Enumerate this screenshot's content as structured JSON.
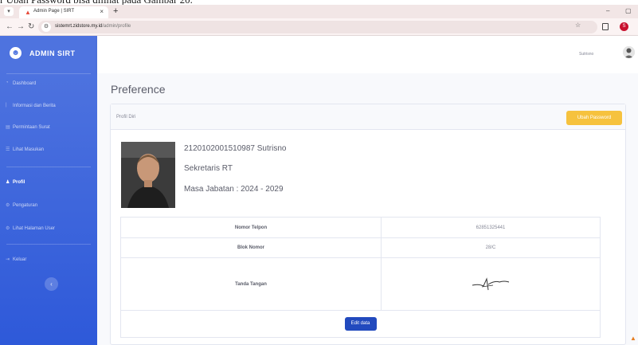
{
  "caption": "r Ubah Password bisa dilihat pada Gambar 20.",
  "browser": {
    "tab_title": "Admin Page | SIRT",
    "url_domain": "sistemrt.zidstore.my.id",
    "url_path": "/admin/profile",
    "profile_letter": "S"
  },
  "sidebar": {
    "brand": "ADMIN SIRT",
    "items": [
      {
        "label": "Dashboard",
        "icon": "dashboard-icon"
      },
      {
        "label": "Informasi dan Berita",
        "icon": "info-icon"
      },
      {
        "label": "Permintaan Surat",
        "icon": "mail-icon"
      },
      {
        "label": "Lihat Masukan",
        "icon": "comments-icon"
      },
      {
        "label": "Profil",
        "icon": "user-icon",
        "active": true
      },
      {
        "label": "Pengaturan",
        "icon": "settings-icon"
      },
      {
        "label": "Lihat Halaman User",
        "icon": "external-icon"
      },
      {
        "label": "Keluar",
        "icon": "logout-icon"
      }
    ],
    "toggle_glyph": "‹"
  },
  "topbar": {
    "user_name": "Sutrisno"
  },
  "main": {
    "page_title": "Preference",
    "card_title": "Profil Diri",
    "change_password_label": "Ubah Password",
    "profile": {
      "name_line": "2120102001510987 Sutrisno",
      "role": "Sekretaris RT",
      "term": "Masa Jabatan : 2024 - 2029"
    },
    "table": [
      {
        "label": "Nomor Telpon",
        "value": "62851325441"
      },
      {
        "label": "Blok Nomor",
        "value": "28/C"
      },
      {
        "label": "Tanda Tangan",
        "value": ""
      }
    ],
    "edit_label": "Edit data"
  },
  "colors": {
    "sidebar": "#4e73df",
    "warning": "#f6c23e",
    "primary": "#224abe"
  }
}
